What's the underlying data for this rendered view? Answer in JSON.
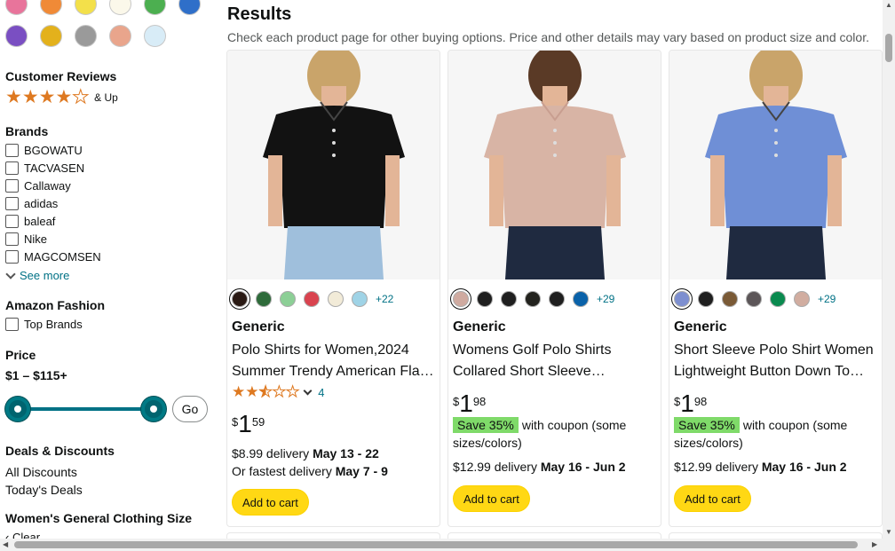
{
  "sidebar": {
    "swatch_rows": [
      [
        "#e8749b",
        "#f08a37",
        "#f3e04a",
        "#fbf8ea",
        "#4caf50",
        "#2f6fc9"
      ],
      [
        "#7a4fc2",
        "#e3b11c",
        "#9a9a9a",
        "#e9a58c",
        "#d8ecf7"
      ]
    ],
    "customer_reviews": {
      "heading": "Customer Reviews",
      "and_up": "& Up",
      "stars": 4
    },
    "brands": {
      "heading": "Brands",
      "items": [
        "BGOWATU",
        "TACVASEN",
        "Callaway",
        "adidas",
        "baleaf",
        "Nike",
        "MAGCOMSEN"
      ],
      "see_more": "See more"
    },
    "amazon_fashion": {
      "heading": "Amazon Fashion",
      "items": [
        "Top Brands"
      ]
    },
    "price": {
      "heading": "Price",
      "range": "$1 – $115+",
      "go": "Go"
    },
    "deals": {
      "heading": "Deals & Discounts",
      "items": [
        "All Discounts",
        "Today's Deals"
      ]
    },
    "clothing_size": {
      "heading": "Women's General Clothing Size",
      "clear": "Clear"
    }
  },
  "main": {
    "title": "Results",
    "subtitle": "Check each product page for other buying options. Price and other details may vary based on product size and color.",
    "products": [
      {
        "shirt_color": "#121212",
        "swatches": [
          "#2a1a14",
          "#2e6b3a",
          "#8ccf96",
          "#d9434f",
          "#f2ebd8",
          "#9fd3e6"
        ],
        "more_colors": "+22",
        "brand": "Generic",
        "title_lines": [
          "Polo Shirts for Women,2024",
          "Summer Trendy American Fla…"
        ],
        "rating": 2.5,
        "rating_count": "4",
        "price_symbol": "$",
        "price_whole": "1",
        "price_fraction": "59",
        "delivery": "$8.99 delivery",
        "delivery_date": "May 13 - 22",
        "fastest": "Or fastest delivery",
        "fastest_date": "May 7 - 9",
        "add_to_cart": "Add to cart"
      },
      {
        "shirt_color": "#d8b4a5",
        "swatches": [
          "#cfaaa0",
          "#1f1f1f",
          "#1f1f1f",
          "#23231e",
          "#1f1f1f",
          "#0a62a9"
        ],
        "more_colors": "+29",
        "brand": "Generic",
        "title_lines": [
          "Womens Golf Polo Shirts",
          "Collared Short Sleeve…"
        ],
        "price_symbol": "$",
        "price_whole": "1",
        "price_fraction": "98",
        "coupon_badge": "Save 35%",
        "coupon_text": "with coupon (some sizes/colors)",
        "delivery": "$12.99 delivery",
        "delivery_date": "May 16 - Jun 2",
        "add_to_cart": "Add to cart"
      },
      {
        "shirt_color": "#6f8fd6",
        "swatches": [
          "#7d8fd0",
          "#1f1f1f",
          "#7a5a36",
          "#5c5658",
          "#0a8a4f",
          "#d1ada0"
        ],
        "more_colors": "+29",
        "brand": "Generic",
        "title_lines": [
          "Short Sleeve Polo Shirt Women",
          "Lightweight Button Down To…"
        ],
        "price_symbol": "$",
        "price_whole": "1",
        "price_fraction": "98",
        "coupon_badge": "Save 35%",
        "coupon_text": "with coupon (some sizes/colors)",
        "delivery": "$12.99 delivery",
        "delivery_date": "May 16 - Jun 2",
        "add_to_cart": "Add to cart"
      }
    ]
  }
}
